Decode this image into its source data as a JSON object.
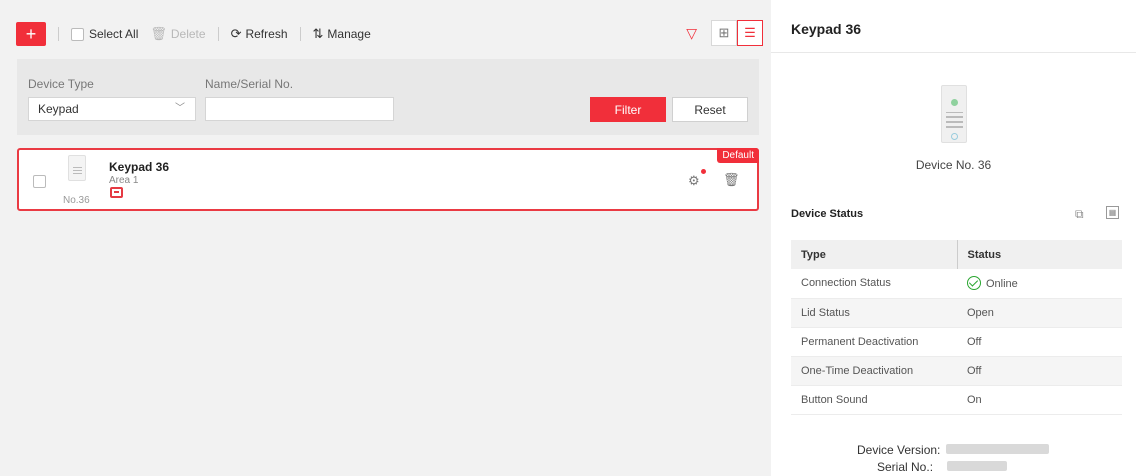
{
  "toolbar": {
    "add_symbol": "+",
    "select_all": "Select All",
    "delete": "Delete",
    "refresh": "Refresh",
    "manage": "Manage"
  },
  "filter": {
    "device_type_label": "Device Type",
    "device_type_value": "Keypad",
    "name_serial_label": "Name/Serial No.",
    "name_serial_value": "",
    "filter_button": "Filter",
    "reset_button": "Reset"
  },
  "devices": [
    {
      "name": "Keypad 36",
      "area": "Area 1",
      "number": "No.36",
      "tag": "Default"
    }
  ],
  "detail": {
    "title": "Keypad 36",
    "device_no": "Device No. 36",
    "status_title": "Device Status",
    "table_headers": [
      "Type",
      "Status"
    ],
    "rows": [
      {
        "type": "Connection Status",
        "status": "Online",
        "tone": "ok"
      },
      {
        "type": "Lid Status",
        "status": "Open",
        "tone": "alert"
      },
      {
        "type": "Permanent Deactivation",
        "status": "Off",
        "tone": "ok"
      },
      {
        "type": "One-Time Deactivation",
        "status": "Off",
        "tone": "ok"
      },
      {
        "type": "Button Sound",
        "status": "On",
        "tone": "neutral"
      }
    ],
    "device_version_label": "Device Version:",
    "serial_no_label": "Serial No.:"
  },
  "colors": {
    "accent": "#f12f3a",
    "ok": "#2aa630",
    "alert": "#e52929"
  }
}
